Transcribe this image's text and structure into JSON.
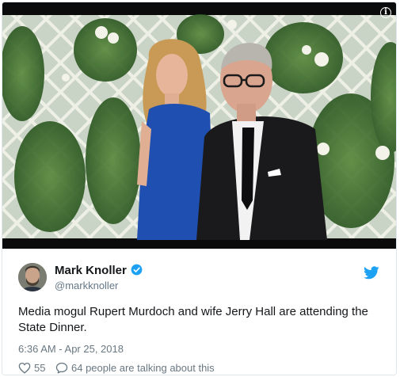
{
  "tweet": {
    "author_name": "Mark Knoller",
    "author_handle": "@markknoller",
    "verified": true,
    "text": "Media mogul Rupert Murdoch and wife Jerry Hall are attending the State Dinner.",
    "timestamp": "6:36 AM - Apr 25, 2018",
    "like_count": "55",
    "talking_text": "64 people are talking about this"
  },
  "media": {
    "info_glyph": "i",
    "colors": {
      "background": "#0b0b0b",
      "lattice": "#e7e9dc",
      "foliage": "#3d6b2e",
      "dress": "#1f4fb0",
      "suit": "#1a1a1c"
    }
  },
  "icons": {
    "verified": "verified-badge-icon",
    "brand": "twitter-bird-icon",
    "like": "heart-icon",
    "reply": "speech-bubble-icon",
    "info": "info-icon"
  },
  "colors": {
    "accent": "#1da1f2",
    "text": "#14171a",
    "muted": "#697882",
    "border": "#e1e8ed"
  }
}
